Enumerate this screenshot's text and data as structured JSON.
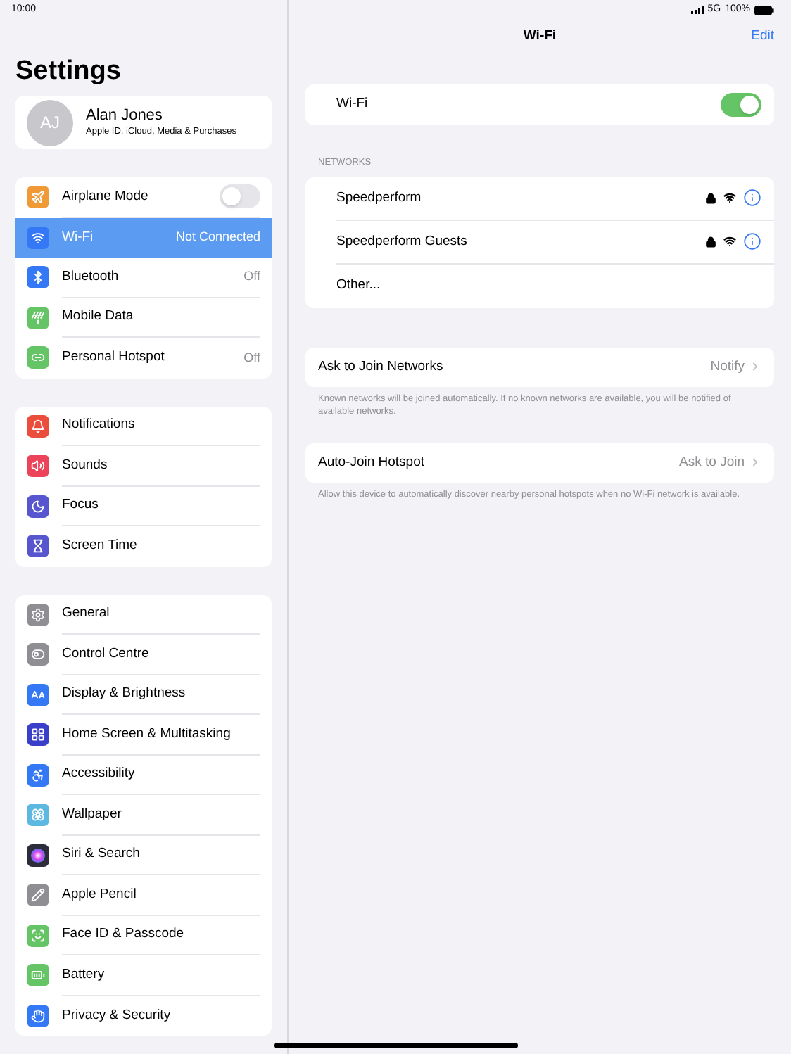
{
  "status_bar": {
    "time": "10:00",
    "network": "5G",
    "battery": "100%"
  },
  "sidebar": {
    "title": "Settings",
    "profile": {
      "initials": "AJ",
      "name": "Alan Jones",
      "subtitle": "Apple ID, iCloud, Media & Purchases"
    },
    "groups": [
      [
        {
          "label": "Airplane Mode",
          "kind": "toggle",
          "on": false,
          "selected": false,
          "color": "#f09a37"
        },
        {
          "label": "Wi-Fi",
          "kind": "value",
          "value": "Not Connected",
          "selected": true,
          "color": "#3478f6"
        },
        {
          "label": "Bluetooth",
          "kind": "value",
          "value": "Off",
          "selected": false,
          "color": "#3478f6"
        },
        {
          "label": "Mobile Data",
          "kind": "plain",
          "selected": false,
          "color": "#65c466"
        },
        {
          "label": "Personal Hotspot",
          "kind": "value",
          "value": "Off",
          "selected": false,
          "color": "#65c466"
        }
      ],
      [
        {
          "label": "Notifications",
          "kind": "plain",
          "selected": false,
          "color": "#eb4d3d"
        },
        {
          "label": "Sounds",
          "kind": "plain",
          "selected": false,
          "color": "#eb445a"
        },
        {
          "label": "Focus",
          "kind": "plain",
          "selected": false,
          "color": "#5756ce"
        },
        {
          "label": "Screen Time",
          "kind": "plain",
          "selected": false,
          "color": "#5756ce"
        }
      ],
      [
        {
          "label": "General",
          "kind": "plain",
          "selected": false,
          "color": "#8e8e93"
        },
        {
          "label": "Control Centre",
          "kind": "plain",
          "selected": false,
          "color": "#8e8e93"
        },
        {
          "label": "Display & Brightness",
          "kind": "plain",
          "selected": false,
          "color": "#3478f6"
        },
        {
          "label": "Home Screen & Multitasking",
          "kind": "plain",
          "selected": false,
          "color": "#3a3fc9"
        },
        {
          "label": "Accessibility",
          "kind": "plain",
          "selected": false,
          "color": "#3478f6"
        },
        {
          "label": "Wallpaper",
          "kind": "plain",
          "selected": false,
          "color": "#5cb8e0"
        },
        {
          "label": "Siri & Search",
          "kind": "plain",
          "selected": false,
          "color": "#2c2c3a"
        },
        {
          "label": "Apple Pencil",
          "kind": "plain",
          "selected": false,
          "color": "#8e8e93"
        },
        {
          "label": "Face ID & Passcode",
          "kind": "plain",
          "selected": false,
          "color": "#65c466"
        },
        {
          "label": "Battery",
          "kind": "plain",
          "selected": false,
          "color": "#65c466"
        },
        {
          "label": "Privacy & Security",
          "kind": "plain",
          "selected": false,
          "color": "#3478f6"
        }
      ]
    ]
  },
  "detail": {
    "title": "Wi-Fi",
    "edit": "Edit",
    "wifi": {
      "label": "Wi-Fi",
      "on": true
    },
    "networks_header": "NETWORKS",
    "networks": [
      {
        "name": "Speedperform",
        "kind": "network"
      },
      {
        "name": "Speedperform Guests",
        "kind": "network"
      },
      {
        "name": "Other...",
        "kind": "other"
      }
    ],
    "options": [
      {
        "label": "Ask to Join Networks",
        "value": "Notify",
        "footer": "Known networks will be joined automatically. If no known networks are available, you will be notified of available networks."
      },
      {
        "label": "Auto-Join Hotspot",
        "value": "Ask to Join",
        "footer": "Allow this device to automatically discover nearby personal hotspots when no Wi-Fi network is available."
      }
    ]
  }
}
